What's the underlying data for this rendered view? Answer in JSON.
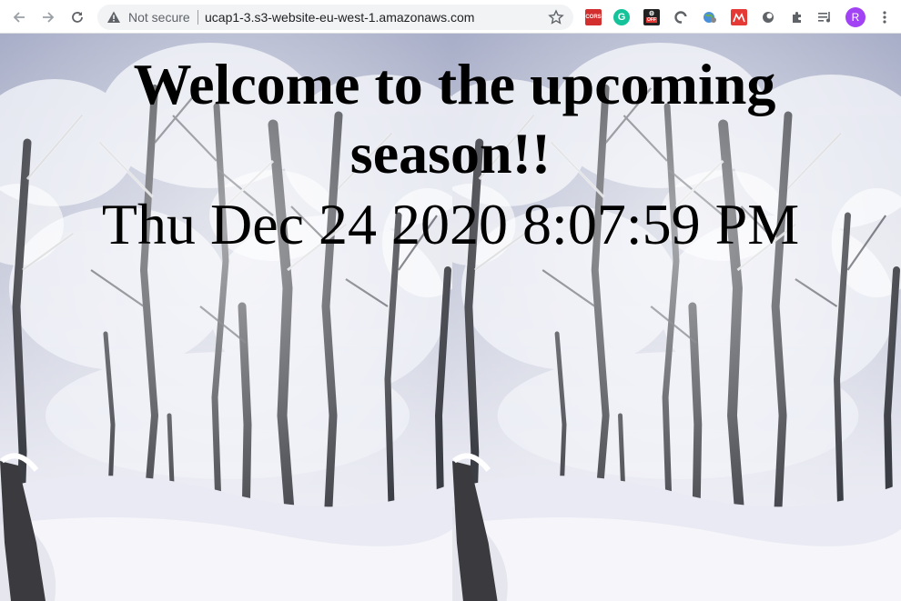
{
  "browser": {
    "security_label": "Not secure",
    "url": "ucap1-3.s3-website-eu-west-1.amazonaws.com",
    "extensions": [
      {
        "name": "cors-extension-icon",
        "label": "CORS"
      },
      {
        "name": "grammarly-icon",
        "label": "G"
      },
      {
        "name": "off-extension-icon",
        "label": "OFF"
      },
      {
        "name": "sync-extension-icon",
        "label": ""
      },
      {
        "name": "globe-extension-icon",
        "label": ""
      },
      {
        "name": "red-extension-icon",
        "label": ""
      },
      {
        "name": "circle-extension-icon",
        "label": ""
      },
      {
        "name": "puzzle-extensions-icon",
        "label": ""
      },
      {
        "name": "media-controls-icon",
        "label": ""
      }
    ],
    "profile_initial": "R"
  },
  "page": {
    "headline_line1": "Welcome to the upcoming",
    "headline_line2": "season!!",
    "datetime": "Thu Dec 24 2020 8:07:59 PM",
    "background": "snowy forest"
  }
}
